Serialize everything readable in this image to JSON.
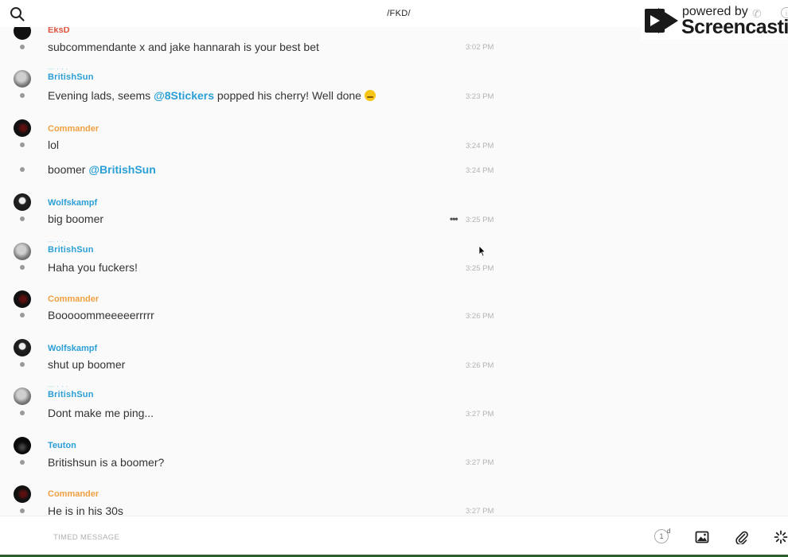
{
  "header": {
    "channel": "/FKD/"
  },
  "watermark": {
    "powered_by": "powered by",
    "brand": "Screencastify"
  },
  "messages": [
    {
      "author": "EksD",
      "author_color": "#e0543f",
      "text": "subcommendante x and jake hannarah is your best bet",
      "time": "3:02 PM",
      "avatar": "dark"
    },
    {
      "author": "BritishSun",
      "author_color": "#2b9fd6",
      "decorated": true,
      "text_pre": "Evening lads, seems ",
      "mention": "@8Stickers",
      "text_post": " popped his cherry! Well done",
      "emoji": "smirk-emoji",
      "time": "3:23 PM",
      "avatar": "grey"
    },
    {
      "author": "Commander",
      "author_color": "#f0a040",
      "text": "lol",
      "time": "3:24 PM",
      "avatar": "red"
    },
    {
      "continuation": true,
      "text_pre": "boomer ",
      "mention": "@BritishSun",
      "time": "3:24 PM"
    },
    {
      "author": "Wolfskampf",
      "author_color": "#2b9fd6",
      "text": "big boomer",
      "time": "3:25 PM",
      "avatar": "skull",
      "more": "•••"
    },
    {
      "author": "BritishSun",
      "author_color": "#2b9fd6",
      "decorated": true,
      "text": "Haha you fuckers!",
      "time": "3:25 PM",
      "avatar": "grey"
    },
    {
      "author": "Commander",
      "author_color": "#f0a040",
      "text": "Booooommeeeeerrrrr",
      "time": "3:26 PM",
      "avatar": "red"
    },
    {
      "author": "Wolfskampf",
      "author_color": "#2b9fd6",
      "text": "shut up boomer",
      "time": "3:26 PM",
      "avatar": "skull"
    },
    {
      "author": "BritishSun",
      "author_color": "#2b9fd6",
      "decorated": true,
      "text": "Dont make me ping...",
      "time": "3:27 PM",
      "avatar": "grey"
    },
    {
      "author": "Teuton",
      "author_color": "#2b9fd6",
      "text": "Britishsun is a boomer?",
      "time": "3:27 PM",
      "avatar": "teuton"
    },
    {
      "author": "Commander",
      "author_color": "#f0a040",
      "text": "He is in his 30s",
      "time": "3:27 PM",
      "avatar": "red"
    }
  ],
  "composer": {
    "timed_message": "TIMED MESSAGE",
    "counter": "1",
    "counter_unit": "d"
  },
  "colors": {
    "mention": "#2b9fd6",
    "bottom_accent": "#2c5f2d"
  }
}
